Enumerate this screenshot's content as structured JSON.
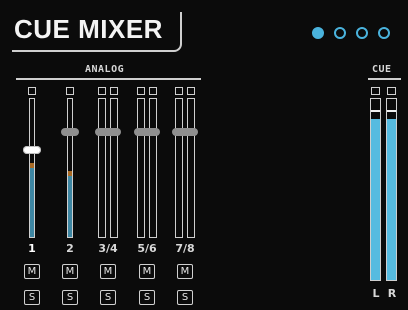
{
  "title": "CUE MIXER",
  "pages": {
    "count": 4,
    "active_index": 0
  },
  "sections": {
    "analog": "ANALOG",
    "cue": "CUE"
  },
  "channels": [
    {
      "label": "1",
      "mute": "M",
      "solo": "S",
      "selected": true,
      "fader_level": 0.63,
      "meter_levels": [
        0.5
      ]
    },
    {
      "label": "2",
      "mute": "M",
      "solo": "S",
      "selected": false,
      "fader_level": 0.76,
      "meter_levels": [
        0.44
      ]
    },
    {
      "label": "3/4",
      "mute": "M",
      "solo": "S",
      "selected": false,
      "fader_level": 0.76,
      "meter_levels": [
        0,
        0
      ]
    },
    {
      "label": "5/6",
      "mute": "M",
      "solo": "S",
      "selected": false,
      "fader_level": 0.76,
      "meter_levels": [
        0,
        0
      ]
    },
    {
      "label": "7/8",
      "mute": "M",
      "solo": "S",
      "selected": false,
      "fader_level": 0.76,
      "meter_levels": [
        0,
        0
      ]
    }
  ],
  "cue_meters": [
    {
      "label": "L",
      "level": 0.88,
      "peak": 0.92
    },
    {
      "label": "R",
      "level": 0.88,
      "peak": 0.92
    }
  ],
  "colors": {
    "accent": "#4ab3dd",
    "meter_fill": "#3e87a3",
    "cue_fill": "#56bbe0",
    "peak_orange": "#a86a25"
  }
}
